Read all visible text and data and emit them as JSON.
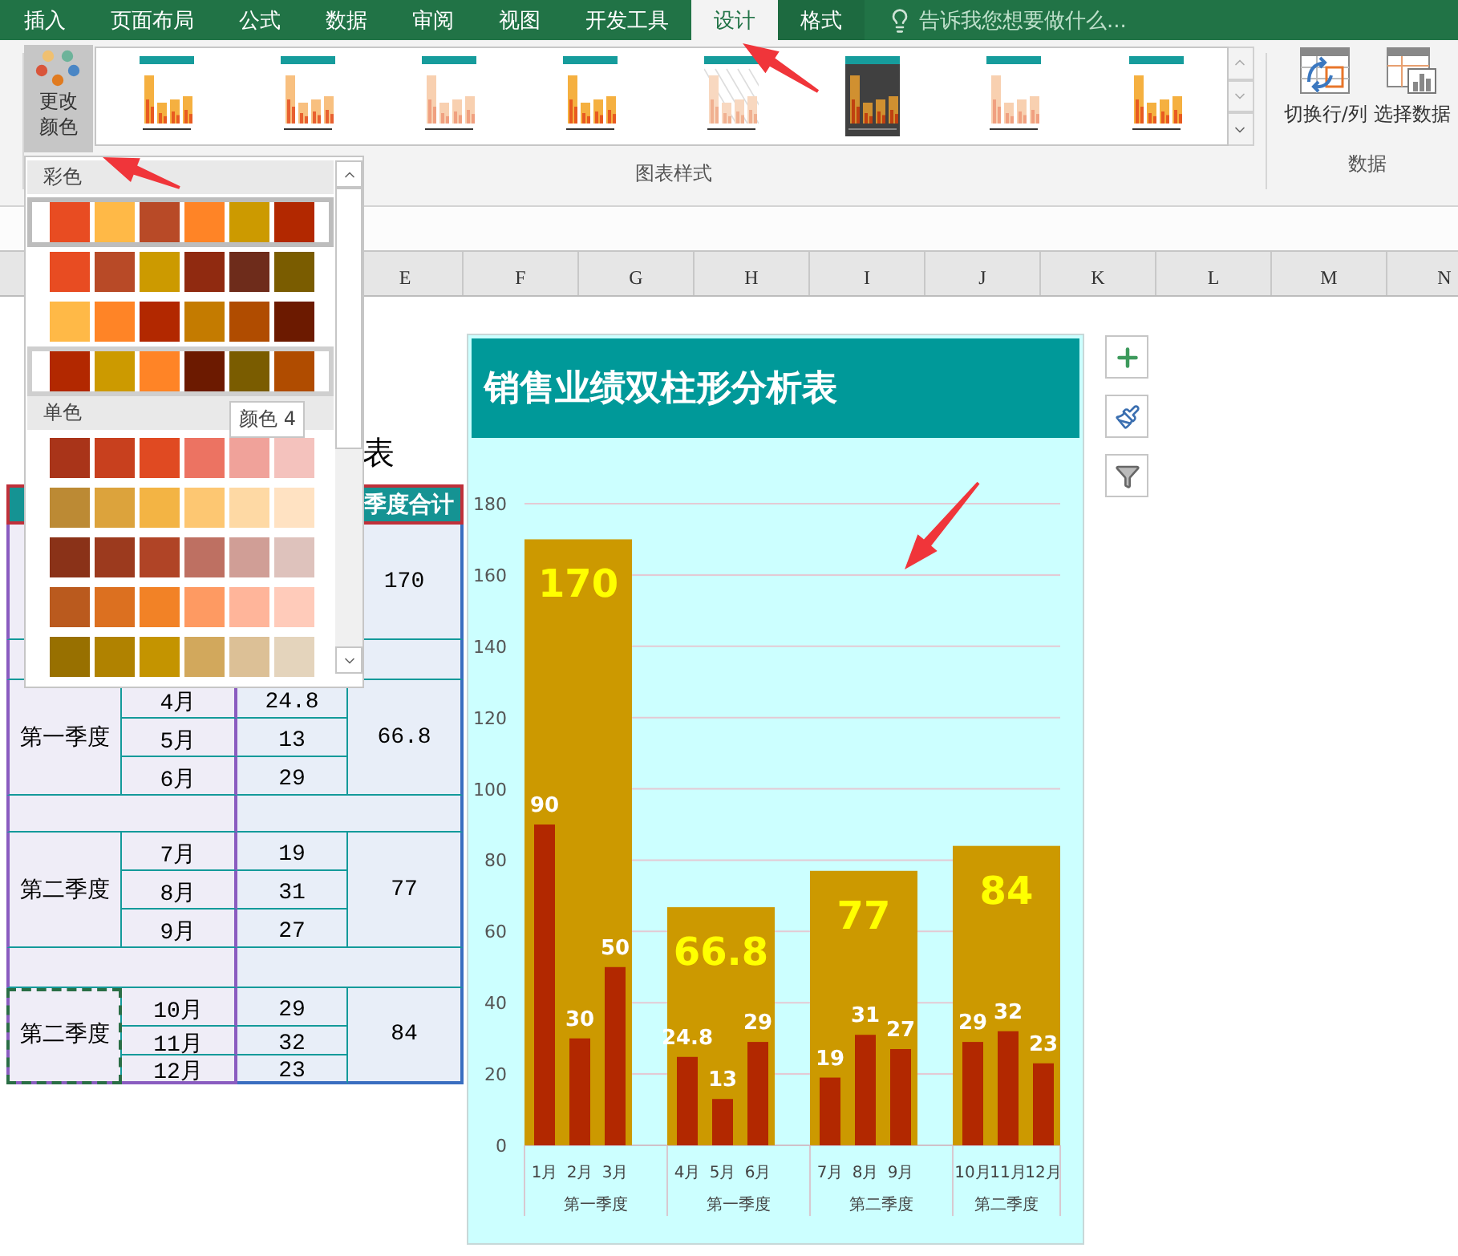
{
  "ribbon_tabs": [
    {
      "label": "插入",
      "selected": false
    },
    {
      "label": "页面布局",
      "selected": false
    },
    {
      "label": "公式",
      "selected": false
    },
    {
      "label": "数据",
      "selected": false
    },
    {
      "label": "审阅",
      "selected": false
    },
    {
      "label": "视图",
      "selected": false
    },
    {
      "label": "开发工具",
      "selected": false
    },
    {
      "label": "设计",
      "selected": true
    },
    {
      "label": "格式",
      "selected": false
    }
  ],
  "tell_me": {
    "placeholder": "告诉我您想要做什么..."
  },
  "change_colors": {
    "label": "更改颜色",
    "pressed": true
  },
  "chart_styles": [
    {
      "kind": "plain"
    },
    {
      "kind": "striped"
    },
    {
      "kind": "pale"
    },
    {
      "kind": "plain"
    },
    {
      "kind": "hatched"
    },
    {
      "kind": "dark"
    },
    {
      "kind": "pale"
    },
    {
      "kind": "plain"
    }
  ],
  "chart_styles_group": "图表样式",
  "data_group": {
    "label": "数据",
    "buttons": [
      {
        "kind": "switch",
        "label": "切换行/列"
      },
      {
        "kind": "select",
        "label": "选择数据"
      }
    ]
  },
  "columns": [
    "E",
    "F",
    "G",
    "H",
    "I",
    "J",
    "K",
    "L",
    "M",
    "N"
  ],
  "color_menu": {
    "sections": [
      {
        "title": "彩色",
        "palettes": [
          {
            "selected": true,
            "hovered": false,
            "swatches": [
              {
                "color": "#e84c22"
              },
              {
                "color": "#ffb947"
              },
              {
                "color": "#b84a27"
              },
              {
                "color": "#ff8426"
              },
              {
                "color": "#cc9a00"
              },
              {
                "color": "#b22800"
              }
            ]
          },
          {
            "selected": false,
            "hovered": false,
            "swatches": [
              {
                "color": "#e84c22"
              },
              {
                "color": "#b84a27"
              },
              {
                "color": "#cc9a00"
              },
              {
                "color": "#902a10"
              },
              {
                "color": "#6e2c1b"
              },
              {
                "color": "#7a5c00"
              }
            ]
          },
          {
            "selected": false,
            "hovered": false,
            "swatches": [
              {
                "color": "#ffb947"
              },
              {
                "color": "#ff8426"
              },
              {
                "color": "#b22800"
              },
              {
                "color": "#c47b00"
              },
              {
                "color": "#b04c00"
              },
              {
                "color": "#6c1a00"
              }
            ]
          },
          {
            "selected": false,
            "hovered": true,
            "swatches": [
              {
                "color": "#b22800"
              },
              {
                "color": "#cc9a00"
              },
              {
                "color": "#ff8426"
              },
              {
                "color": "#6c1a00"
              },
              {
                "color": "#7a5c00"
              },
              {
                "color": "#b04c00"
              }
            ]
          }
        ]
      },
      {
        "title": "单色",
        "palettes": [
          {
            "selected": false,
            "hovered": false,
            "swatches": [
              {
                "color": "#a93419"
              },
              {
                "color": "#c8401e"
              },
              {
                "color": "#e04a22"
              },
              {
                "color": "#ec7362"
              },
              {
                "color": "#f0a29a"
              },
              {
                "color": "#f4c2bd"
              }
            ]
          },
          {
            "selected": false,
            "hovered": false,
            "swatches": [
              {
                "color": "#bc8a34"
              },
              {
                "color": "#dca33c"
              },
              {
                "color": "#f3b444"
              },
              {
                "color": "#fdc772"
              },
              {
                "color": "#fed9a4"
              },
              {
                "color": "#ffe2c2"
              }
            ]
          },
          {
            "selected": false,
            "hovered": false,
            "swatches": [
              {
                "color": "#8a3218"
              },
              {
                "color": "#9c3a1e"
              },
              {
                "color": "#b04426"
              },
              {
                "color": "#be7062"
              },
              {
                "color": "#d09e96"
              },
              {
                "color": "#dec2bc"
              }
            ]
          },
          {
            "selected": false,
            "hovered": false,
            "swatches": [
              {
                "color": "#ba5a1e"
              },
              {
                "color": "#dc7020"
              },
              {
                "color": "#f28226"
              },
              {
                "color": "#fe9a62"
              },
              {
                "color": "#ffb59a"
              },
              {
                "color": "#ffcbba"
              }
            ]
          },
          {
            "selected": false,
            "hovered": false,
            "swatches": [
              {
                "color": "#987000"
              },
              {
                "color": "#b08200"
              },
              {
                "color": "#c49400"
              },
              {
                "color": "#d2a85c"
              },
              {
                "color": "#dcc096"
              },
              {
                "color": "#e4d4bc"
              }
            ]
          }
        ]
      }
    ],
    "tooltip": "颜色 4"
  },
  "table": {
    "title": "表",
    "header": "季度合计",
    "blocks": [
      {
        "selected": false,
        "total": "170"
      },
      {
        "quarter": "第一季度",
        "selected": false,
        "months": [
          "4月",
          "5月",
          "6月"
        ],
        "values": [
          "24.8",
          "13",
          "29"
        ],
        "total": "66.8"
      },
      {
        "quarter": "第二季度",
        "selected": false,
        "months": [
          "7月",
          "8月",
          "9月"
        ],
        "values": [
          "19",
          "31",
          "27"
        ],
        "total": "77"
      },
      {
        "quarter": "第二季度",
        "selected": true,
        "months": [
          "10月",
          "11月",
          "12月"
        ],
        "values": [
          "29",
          "32",
          "23"
        ],
        "total": "84"
      }
    ]
  },
  "chart": {
    "title": "销售业绩双柱形分析表",
    "month_labels": [
      "1月",
      "2月",
      "3月",
      "4月",
      "5月",
      "6月",
      "7月",
      "8月",
      "9月",
      "10月",
      "11月",
      "12月"
    ],
    "chart_data": {
      "type": "bar",
      "categories": [
        "第一季度",
        "第一季度",
        "第二季度",
        "第二季度"
      ],
      "series": [
        {
          "color": "#cc9900",
          "values": [
            170,
            66.8,
            77,
            84
          ]
        },
        {
          "color": "#b22800",
          "values": [
            90,
            24.8,
            19,
            29
          ]
        },
        {
          "color": "#b22800",
          "values": [
            30,
            13,
            31,
            32
          ]
        },
        {
          "color": "#b22800",
          "values": [
            50,
            29,
            27,
            23
          ]
        }
      ],
      "ylim": [
        0,
        180
      ],
      "yticks": [
        0,
        20,
        40,
        60,
        80,
        100,
        120,
        140,
        160,
        180
      ],
      "grid": true,
      "data_labels": true
    }
  }
}
